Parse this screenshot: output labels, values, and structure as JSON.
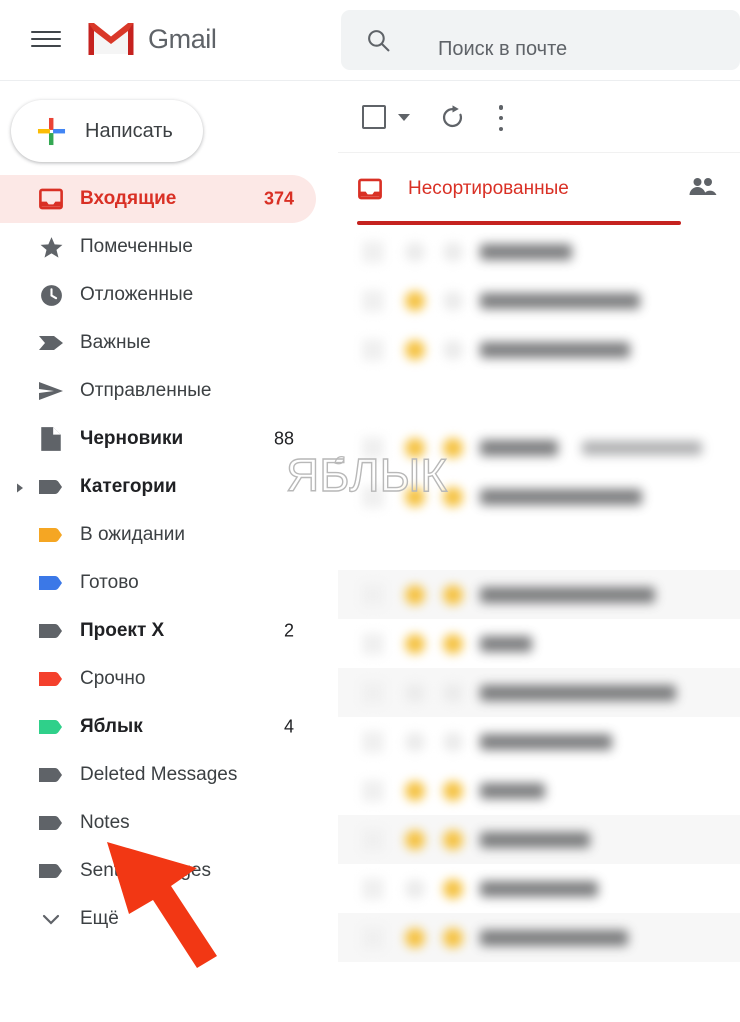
{
  "app": {
    "name": "Gmail",
    "brand_red": "#d93025",
    "accent_underline": "#c5221f",
    "active_row_bg": "#fce8e6"
  },
  "topbar": {
    "menu_icon": "hamburger-menu-icon",
    "logo_icon": "gmail-logo-icon",
    "title": "Gmail",
    "search": {
      "icon": "search-icon",
      "placeholder": "Поиск в почте",
      "value": ""
    }
  },
  "sidebar": {
    "compose": {
      "label": "Написать",
      "icon": "plus-icon"
    },
    "items": [
      {
        "label": "Входящие",
        "count": "374",
        "icon": "inbox-icon",
        "active": true,
        "bold": true,
        "caret": false,
        "color": "#d93025"
      },
      {
        "label": "Помеченные",
        "count": "",
        "icon": "star-icon",
        "active": false,
        "bold": false,
        "caret": false,
        "color": "#5f6368"
      },
      {
        "label": "Отложенные",
        "count": "",
        "icon": "clock-icon",
        "active": false,
        "bold": false,
        "caret": false,
        "color": "#5f6368"
      },
      {
        "label": "Важные",
        "count": "",
        "icon": "important-icon",
        "active": false,
        "bold": false,
        "caret": false,
        "color": "#5f6368"
      },
      {
        "label": "Отправленные",
        "count": "",
        "icon": "send-icon",
        "active": false,
        "bold": false,
        "caret": false,
        "color": "#5f6368"
      },
      {
        "label": "Черновики",
        "count": "88",
        "icon": "draft-icon",
        "active": false,
        "bold": true,
        "caret": false,
        "color": "#5f6368"
      },
      {
        "label": "Категории",
        "count": "",
        "icon": "label-icon",
        "active": false,
        "bold": true,
        "caret": true,
        "color": "#5f6368"
      },
      {
        "label": "В ожидании",
        "count": "",
        "icon": "label-icon",
        "active": false,
        "bold": false,
        "caret": false,
        "color": "#f5a623"
      },
      {
        "label": "Готово",
        "count": "",
        "icon": "label-icon",
        "active": false,
        "bold": false,
        "caret": false,
        "color": "#3b78e7"
      },
      {
        "label": "Проект X",
        "count": "2",
        "icon": "label-icon",
        "active": false,
        "bold": true,
        "caret": false,
        "color": "#5f6368"
      },
      {
        "label": "Срочно",
        "count": "",
        "icon": "label-icon",
        "active": false,
        "bold": false,
        "caret": false,
        "color": "#f4402c"
      },
      {
        "label": "Яблык",
        "count": "4",
        "icon": "label-icon",
        "active": false,
        "bold": true,
        "caret": false,
        "color": "#2fd08a"
      },
      {
        "label": "Deleted Messages",
        "count": "",
        "icon": "label-icon",
        "active": false,
        "bold": false,
        "caret": false,
        "color": "#5f6368"
      },
      {
        "label": "Notes",
        "count": "",
        "icon": "label-icon",
        "active": false,
        "bold": false,
        "caret": false,
        "color": "#5f6368"
      },
      {
        "label": "Sent Messages",
        "count": "",
        "icon": "label-icon",
        "active": false,
        "bold": false,
        "caret": false,
        "color": "#5f6368"
      },
      {
        "label": "Ещё",
        "count": "",
        "icon": "chevron-down-icon",
        "active": false,
        "bold": false,
        "caret": false,
        "color": "#5f6368"
      }
    ]
  },
  "toolbar": {
    "select_all_icon": "checkbox-icon",
    "select_all_caret_icon": "chevron-down-icon",
    "refresh_icon": "refresh-icon",
    "more_options_icon": "three-dot-menu-icon"
  },
  "tabs": {
    "primary": {
      "label": "Несортированные",
      "icon": "inbox-icon",
      "selected": true
    },
    "contacts_icon": "people-icon"
  },
  "mail_list": {
    "blurred": true,
    "rows": [
      {
        "starred": false,
        "important": false,
        "shaded": false,
        "sender_w": 92,
        "subject_w": 0
      },
      {
        "starred": true,
        "important": false,
        "shaded": false,
        "sender_w": 160,
        "subject_w": 0
      },
      {
        "starred": true,
        "important": false,
        "shaded": false,
        "sender_w": 150,
        "subject_w": 0
      },
      {
        "starred": true,
        "important": true,
        "shaded": false,
        "sender_w": 78,
        "subject_w": 120
      },
      {
        "starred": true,
        "important": true,
        "shaded": false,
        "sender_w": 162,
        "subject_w": 0
      },
      {
        "starred": true,
        "important": true,
        "shaded": true,
        "sender_w": 175,
        "subject_w": 0
      },
      {
        "starred": true,
        "important": true,
        "shaded": false,
        "sender_w": 52,
        "subject_w": 0
      },
      {
        "starred": false,
        "important": false,
        "shaded": true,
        "sender_w": 196,
        "subject_w": 0
      },
      {
        "starred": false,
        "important": false,
        "shaded": false,
        "sender_w": 132,
        "subject_w": 0
      },
      {
        "starred": true,
        "important": true,
        "shaded": false,
        "sender_w": 65,
        "subject_w": 0
      },
      {
        "starred": true,
        "important": true,
        "shaded": true,
        "sender_w": 110,
        "subject_w": 0
      },
      {
        "starred": false,
        "important": true,
        "shaded": false,
        "sender_w": 118,
        "subject_w": 0
      },
      {
        "starred": true,
        "important": true,
        "shaded": true,
        "sender_w": 148,
        "subject_w": 0
      }
    ]
  },
  "watermark": {
    "text": "ЯБЛЫК",
    "icon": "apple-icon"
  },
  "annotation": {
    "type": "arrow",
    "color": "#f23714",
    "points_to": "Ещё"
  }
}
